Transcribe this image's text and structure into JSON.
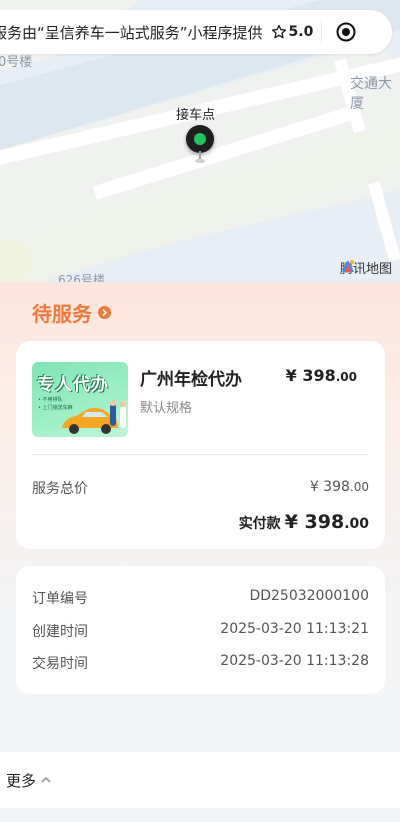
{
  "banner": {
    "text": "服务由“呈信养车一站式服务”小程序提供",
    "rating": "5.0",
    "icons": [
      "star-icon",
      "target-icon"
    ]
  },
  "map": {
    "label_top_left": "0号楼",
    "label_top_right": "交通大厦",
    "label_bottom": "626号楼",
    "pickup_label": "接车点",
    "attribution": "腾讯地图"
  },
  "status": {
    "title": "待服务",
    "accent_color": "#f07a3d"
  },
  "product": {
    "image_title": "专人代办",
    "image_lines": [
      "• 不用排队",
      "• 上门接送车辆"
    ],
    "name": "广州年检代办",
    "price_int": "¥ 398",
    "price_dec": ".00",
    "spec": "默认规格"
  },
  "summary": {
    "total_label": "服务总价",
    "total_int": "¥ 398",
    "total_dec": ".00",
    "paid_label": "实付款",
    "paid_int": "¥ 398",
    "paid_dec": ".00"
  },
  "order": {
    "number_label": "订单编号",
    "number_value": "DD25032000100",
    "created_label": "创建时间",
    "created_value": "2025-03-20 11:13:21",
    "trade_label": "交易时间",
    "trade_value": "2025-03-20 11:13:28"
  },
  "footer": {
    "more_label": "更多"
  }
}
